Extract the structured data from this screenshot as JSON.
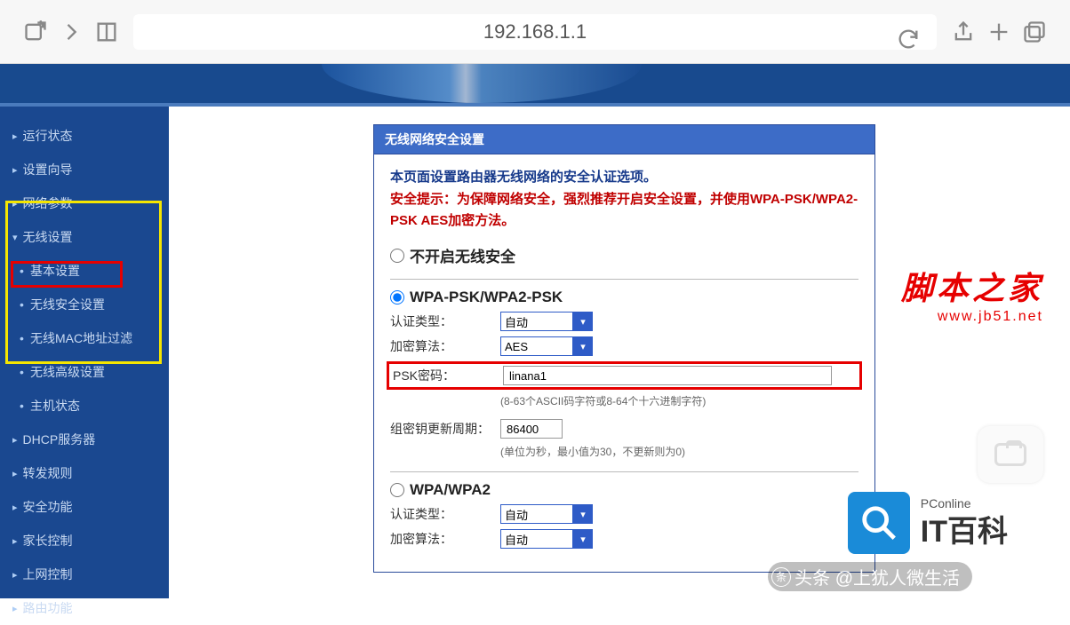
{
  "browser": {
    "address": "192.168.1.1"
  },
  "sidebar": {
    "items": [
      {
        "label": "运行状态",
        "type": "top"
      },
      {
        "label": "设置向导",
        "type": "top"
      },
      {
        "label": "网络参数",
        "type": "top"
      },
      {
        "label": "无线设置",
        "type": "top expanded"
      },
      {
        "label": "基本设置",
        "type": "sub"
      },
      {
        "label": "无线安全设置",
        "type": "sub"
      },
      {
        "label": "无线MAC地址过滤",
        "type": "sub"
      },
      {
        "label": "无线高级设置",
        "type": "sub"
      },
      {
        "label": "主机状态",
        "type": "sub"
      },
      {
        "label": "DHCP服务器",
        "type": "top"
      },
      {
        "label": "转发规则",
        "type": "top"
      },
      {
        "label": "安全功能",
        "type": "top"
      },
      {
        "label": "家长控制",
        "type": "top"
      },
      {
        "label": "上网控制",
        "type": "top"
      },
      {
        "label": "路由功能",
        "type": "top"
      }
    ]
  },
  "panel": {
    "title": "无线网络安全设置",
    "intro": "本页面设置路由器无线网络的安全认证选项。",
    "warn": "安全提示：为保障网络安全，强烈推荐开启安全设置，并使用WPA-PSK/WPA2-PSK AES加密方法。",
    "opt_disable": "不开启无线安全",
    "opt_wpapsk": "WPA-PSK/WPA2-PSK",
    "lbl_auth": "认证类型：",
    "val_auth": "自动",
    "lbl_enc": "加密算法：",
    "val_enc": "AES",
    "lbl_psk": "PSK密码：",
    "val_psk": "linana1",
    "hint_psk": "(8-63个ASCII码字符或8-64个十六进制字符)",
    "lbl_gkey": "组密钥更新周期：",
    "val_gkey": "86400",
    "hint_gkey": "(单位为秒，最小值为30，不更新则为0)",
    "opt_wpa": "WPA/WPA2",
    "lbl_auth2": "认证类型：",
    "val_auth2": "自动",
    "lbl_enc2": "加密算法：",
    "val_enc2": "自动"
  },
  "watermarks": {
    "jb_cn": "脚本之家",
    "jb_url": "www.jb51.net",
    "pc_a": "PConline",
    "pc_b": "IT百科",
    "toutiao": "头条 @上犹人微生活"
  }
}
